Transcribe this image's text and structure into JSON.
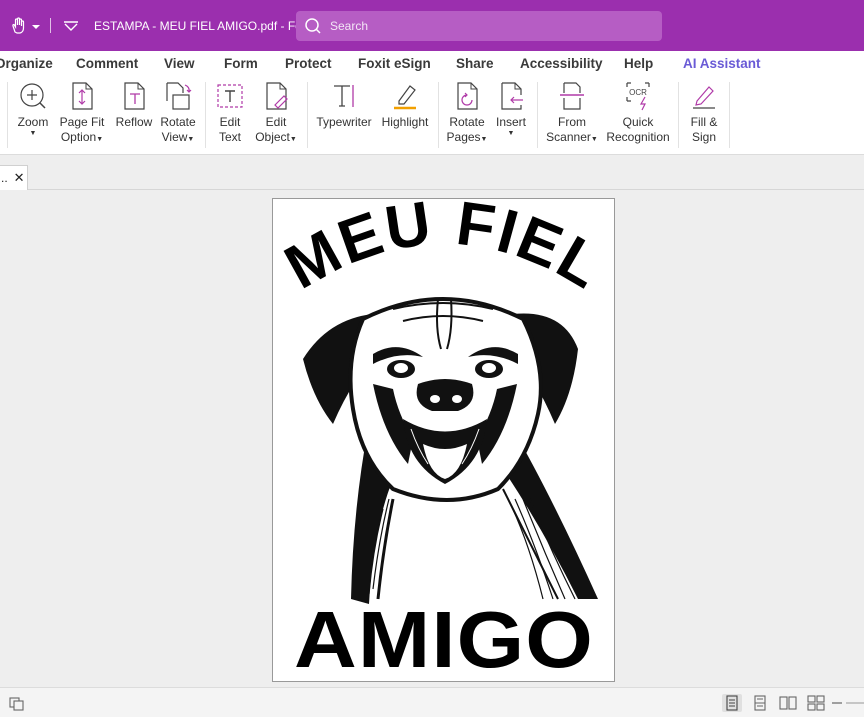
{
  "titlebar": {
    "doc_title": "ESTAMPA - MEU FIEL AMIGO.pdf - Fo...",
    "search_placeholder": "Search",
    "background": "#9b2fae"
  },
  "menu": {
    "items": [
      "Organize",
      "Comment",
      "View",
      "Form",
      "Protect",
      "Foxit eSign",
      "Share",
      "Accessibility",
      "Help",
      "AI Assistant"
    ],
    "ai_color": "#6a5bd6"
  },
  "ribbon": {
    "zoom": {
      "line1": "Zoom",
      "icon": "zoom-icon"
    },
    "page_fit": {
      "line1": "Page Fit",
      "line2": "Option",
      "icon": "page-fit-icon"
    },
    "reflow": {
      "line1": "Reflow",
      "icon": "reflow-icon"
    },
    "rotate_view": {
      "line1": "Rotate",
      "line2": "View",
      "icon": "rotate-view-icon"
    },
    "edit_text": {
      "line1": "Edit",
      "line2": "Text",
      "icon": "edit-text-icon"
    },
    "edit_object": {
      "line1": "Edit",
      "line2": "Object",
      "icon": "edit-object-icon"
    },
    "typewriter": {
      "line1": "Typewriter",
      "icon": "typewriter-icon"
    },
    "highlight": {
      "line1": "Highlight",
      "icon": "highlight-icon"
    },
    "rotate_pages": {
      "line1": "Rotate",
      "line2": "Pages",
      "icon": "rotate-pages-icon"
    },
    "insert": {
      "line1": "Insert",
      "icon": "insert-icon"
    },
    "from_scanner": {
      "line1": "From",
      "line2": "Scanner",
      "icon": "scanner-icon"
    },
    "quick_recognition": {
      "line1": "Quick",
      "line2": "Recognition",
      "icon": "ocr-icon",
      "icon_text": "OCR"
    },
    "fill_sign": {
      "line1": "Fill &",
      "line2": "Sign",
      "icon": "fill-sign-icon"
    }
  },
  "tab": {
    "label": "..",
    "close": "✕"
  },
  "document": {
    "top_text": "MEU FIEL",
    "bottom_text": "AMIGO",
    "image": "boxer-dog-illustration"
  }
}
